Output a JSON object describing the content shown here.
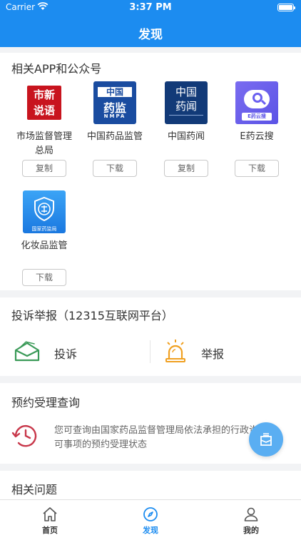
{
  "status_bar": {
    "carrier": "Carrier",
    "time": "3:37 PM"
  },
  "nav": {
    "title": "发现"
  },
  "apps_section": {
    "title": "相关APP和公众号",
    "apps": [
      {
        "name": "市场监督管理总局",
        "logo_text": "市新说语",
        "button": "复制"
      },
      {
        "name": "中国药品监管",
        "logo_text": [
          "中国",
          "药监",
          "NMPA"
        ],
        "button": "下载"
      },
      {
        "name": "中国药闻",
        "logo_text": [
          "中国",
          "药闻"
        ],
        "button": "复制"
      },
      {
        "name": "E药云搜",
        "logo_text": "E药云搜",
        "button": "下载"
      },
      {
        "name": "化妆品监管",
        "logo_text": "国家药监局",
        "button": "下载"
      }
    ]
  },
  "complaint_section": {
    "title": "投诉举报（12315互联网平台）",
    "items": [
      {
        "label": "投诉",
        "icon": "envelope-icon"
      },
      {
        "label": "举报",
        "icon": "alarm-icon"
      }
    ]
  },
  "appointment_section": {
    "title": "预约受理查询",
    "description": "您可查询由国家药品监督管理局依法承担的行政许可事项的预约受理状态",
    "icon": "history-clock-icon"
  },
  "faq_section": {
    "title": "相关问题"
  },
  "tabbar": {
    "tabs": [
      {
        "label": "首页",
        "icon": "home-icon",
        "active": false
      },
      {
        "label": "发现",
        "icon": "compass-icon",
        "active": true
      },
      {
        "label": "我的",
        "icon": "user-icon",
        "active": false
      }
    ]
  },
  "colors": {
    "primary": "#1c8cf0",
    "complaint_green": "#3a9a58",
    "alarm_orange": "#f0a020",
    "history_red": "#c8374a"
  }
}
